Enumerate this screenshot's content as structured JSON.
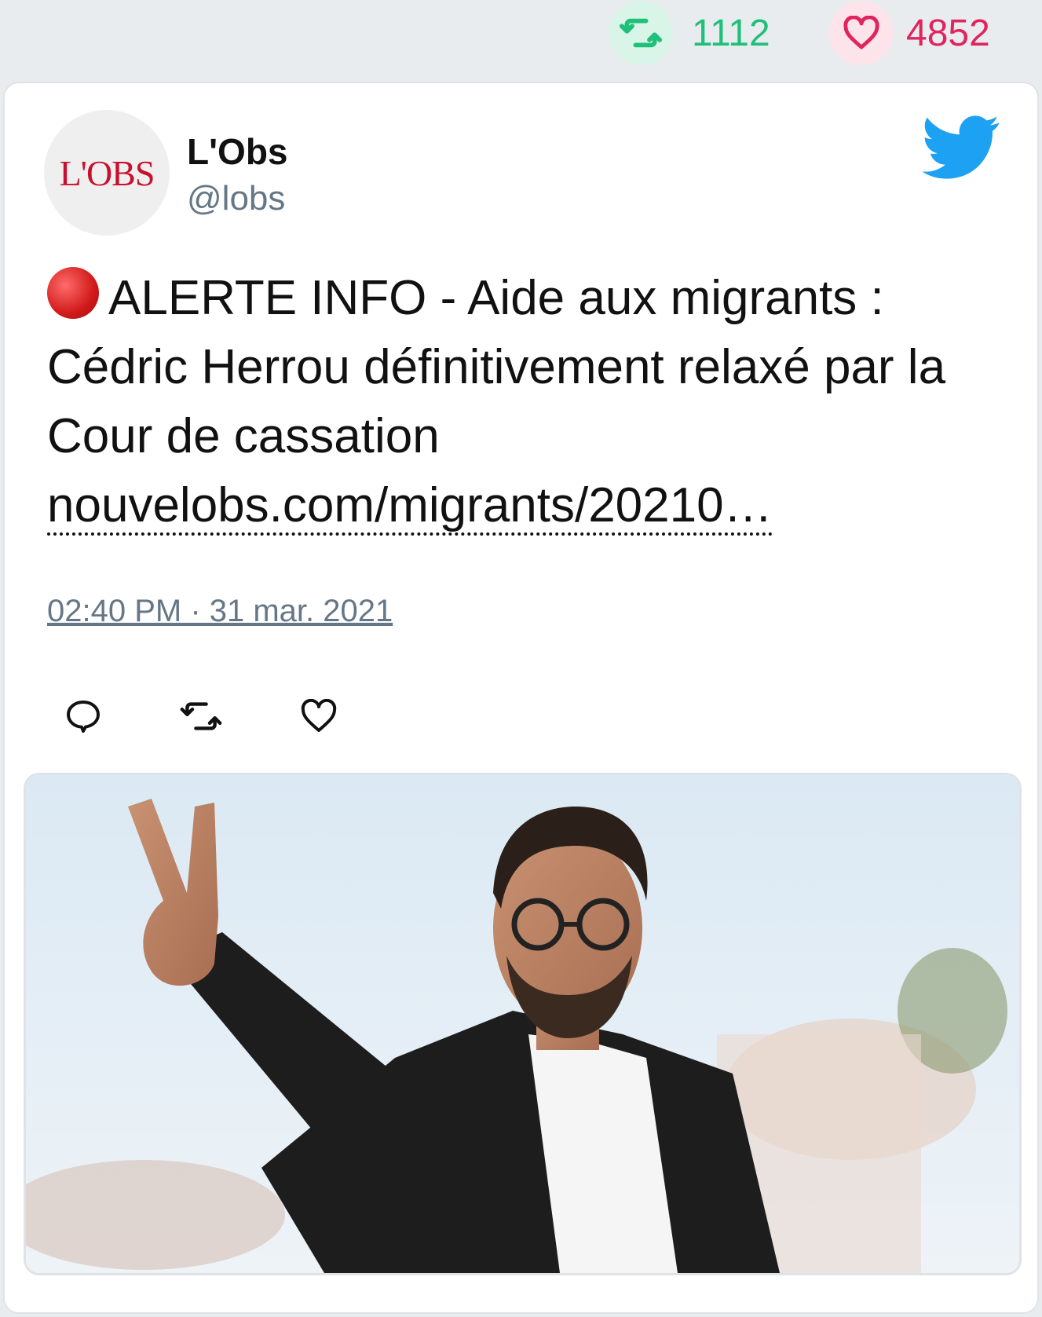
{
  "stats": {
    "retweet_count": "1112",
    "like_count": "4852"
  },
  "tweet": {
    "author_name": "L'Obs",
    "author_handle": "@lobs",
    "avatar_text": "L'OBS",
    "text": "ALERTE INFO - Aide aux migrants : Cédric Herrou définitivement relaxé par la Cour de cassation",
    "link": "nouvelobs.com/migrants/20210…",
    "timestamp": "02:40 PM · 31 mar. 2021"
  },
  "icons": {
    "retweet": "retweet-icon",
    "like": "heart-icon",
    "reply": "reply-icon",
    "brand": "twitter-bird-icon",
    "alert": "red-circle-icon"
  },
  "colors": {
    "retweet": "#1fc07a",
    "like": "#e0245e",
    "twitter_blue": "#1da1f2",
    "muted": "#657786"
  }
}
